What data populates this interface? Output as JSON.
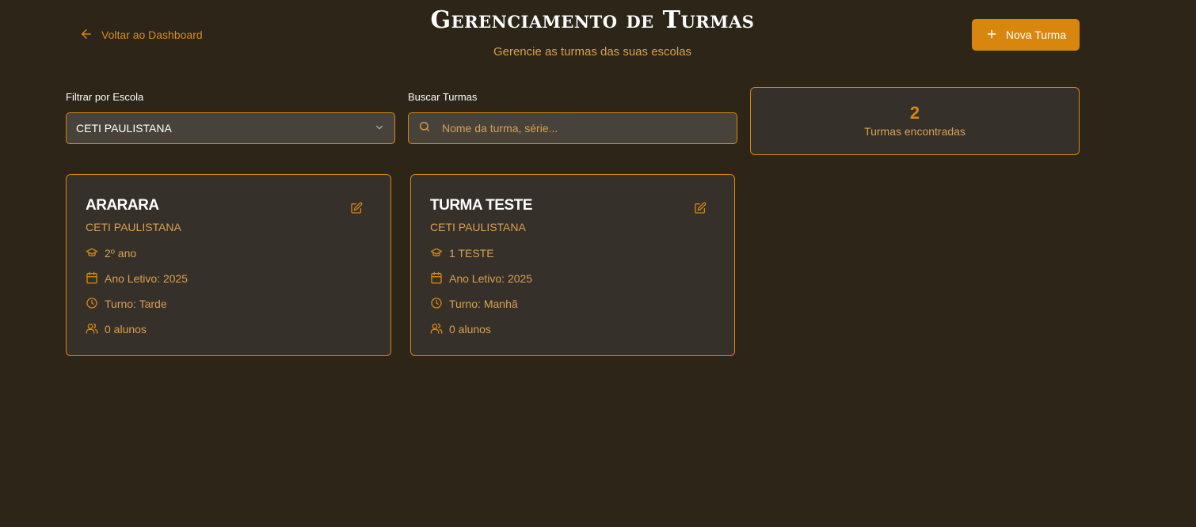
{
  "header": {
    "back_label": "Voltar ao Dashboard",
    "title": "Gerenciamento de Turmas",
    "subtitle": "Gerencie as turmas das suas escolas",
    "new_button_label": "Nova Turma"
  },
  "filters": {
    "school_label": "Filtrar por Escola",
    "school_selected": "CETI PAULISTANA",
    "search_label": "Buscar Turmas",
    "search_placeholder": "Nome da turma, série...",
    "search_value": ""
  },
  "summary": {
    "count": "2",
    "count_label": "Turmas encontradas"
  },
  "classes": [
    {
      "name": "ARARARA",
      "school": "CETI PAULISTANA",
      "grade": "2º ano",
      "year": "Ano Letivo: 2025",
      "shift": "Turno: Tarde",
      "students": "0 alunos"
    },
    {
      "name": "TURMA TESTE",
      "school": "CETI PAULISTANA",
      "grade": "1 TESTE",
      "year": "Ano Letivo: 2025",
      "shift": "Turno: Manhã",
      "students": "0 alunos"
    }
  ],
  "icons": {
    "back": "arrow-left-icon",
    "new": "plus-icon",
    "select": "chevron-down-icon",
    "search": "search-icon",
    "edit": "edit-icon",
    "grade": "graduation-cap-icon",
    "year": "calendar-icon",
    "shift": "clock-icon",
    "students": "users-icon"
  },
  "colors": {
    "background": "#2c2518",
    "accent": "#d9860f",
    "muted_text": "#d9a050",
    "card": "#35302a",
    "input": "#48433a"
  }
}
